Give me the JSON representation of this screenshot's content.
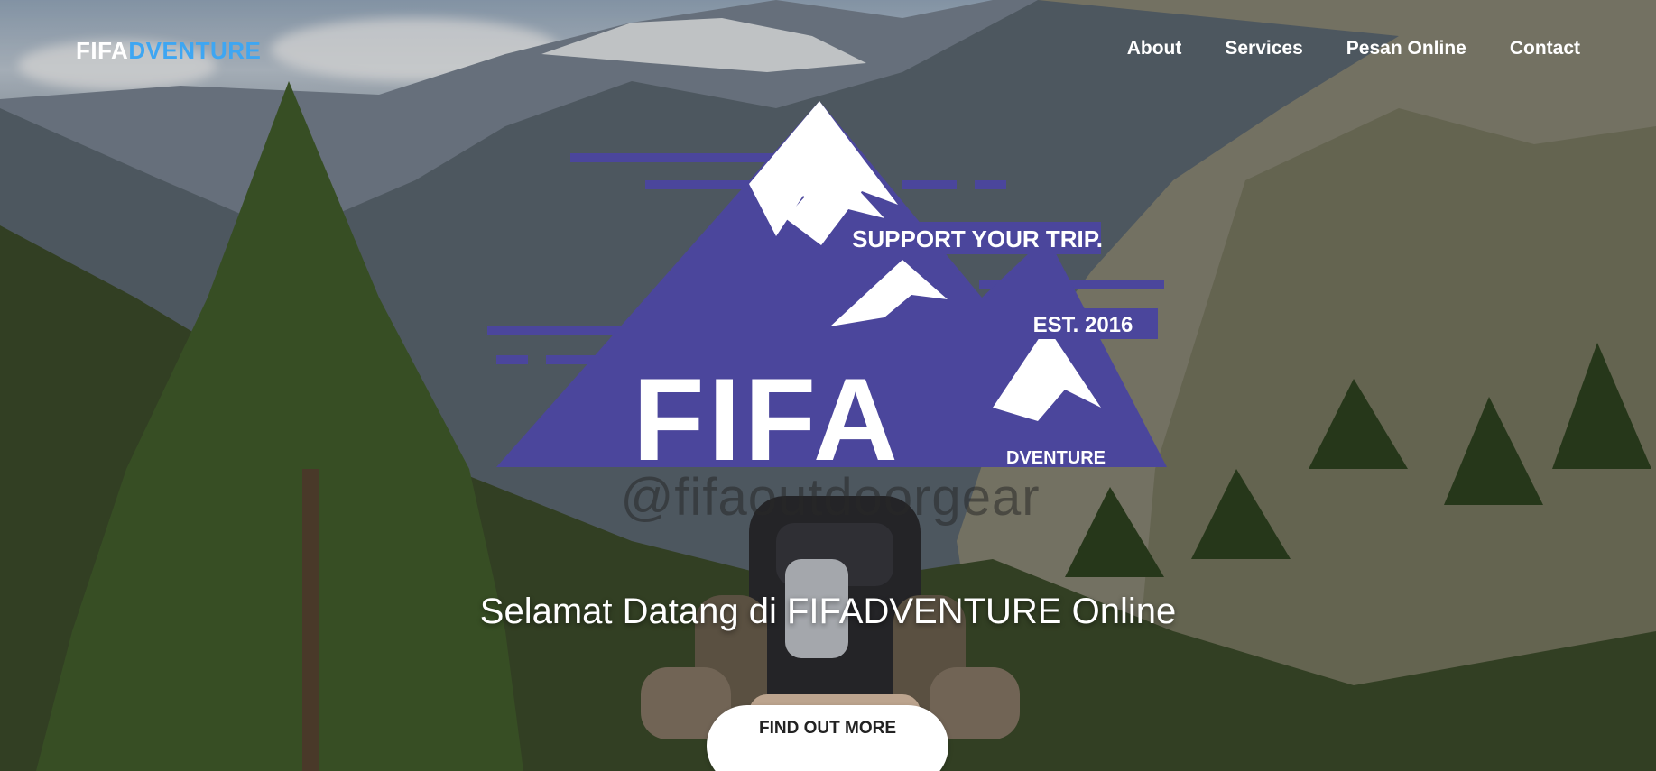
{
  "navbar": {
    "brand_part1": "FIFA",
    "brand_part2": "DVENTURE",
    "links": [
      "About",
      "Services",
      "Pesan Online",
      "Contact"
    ]
  },
  "logo": {
    "tagline": "SUPPORT YOUR TRIP.",
    "established": "EST. 2016",
    "wordmark": "FIFA",
    "subword": "DVENTURE",
    "handle": "@fifaoutdoorgear"
  },
  "hero": {
    "headline": "Selamat Datang di FIFADVENTURE Online",
    "cta_label": "FIND OUT MORE"
  },
  "colors": {
    "brand_accent": "#3ea6f2",
    "logo_purple": "#4b469c",
    "button_bg": "#ffffff"
  }
}
